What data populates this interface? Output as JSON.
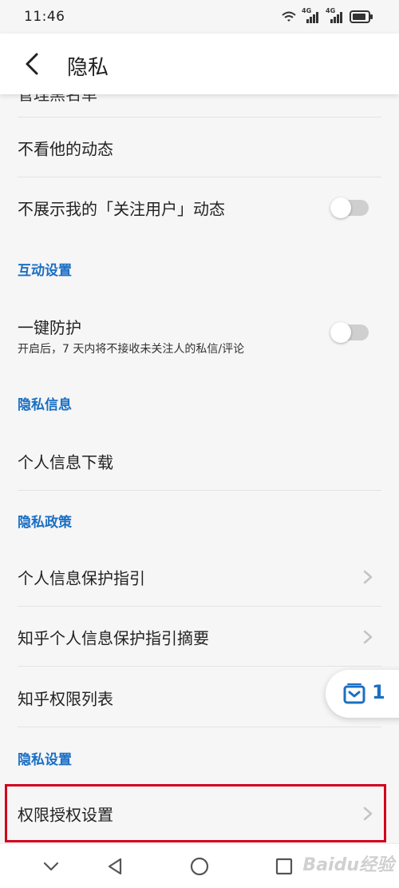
{
  "status_bar": {
    "time": "11:46",
    "network_1": "4G",
    "network_2": "4G"
  },
  "header": {
    "title": "隐私",
    "back_icon": "chevron-left-icon"
  },
  "list": {
    "partial_top_label": "管理黑名单",
    "items": [
      {
        "label": "不看他的动态"
      },
      {
        "label": "不展示我的「关注用户」动态",
        "toggle": "off"
      }
    ],
    "sections": [
      {
        "title": "互动设置",
        "items": [
          {
            "label": "一键防护",
            "sub": "开启后，7 天内将不接收未关注人的私信/评论",
            "toggle": "off"
          }
        ]
      },
      {
        "title": "隐私信息",
        "items": [
          {
            "label": "个人信息下载"
          }
        ]
      },
      {
        "title": "隐私政策",
        "items": [
          {
            "label": "个人信息保护指引"
          },
          {
            "label": "知乎个人信息保护指引摘要"
          },
          {
            "label": "知乎权限列表"
          }
        ]
      },
      {
        "title": "隐私设置",
        "items": [
          {
            "label": "权限授权设置"
          }
        ]
      }
    ]
  },
  "float_badge": {
    "count": "1",
    "icon": "inbox-icon"
  },
  "watermark": "Baidu经验",
  "colors": {
    "accent": "#1a6fc4",
    "highlight": "#d0021b",
    "background": "#f6f6f6"
  }
}
